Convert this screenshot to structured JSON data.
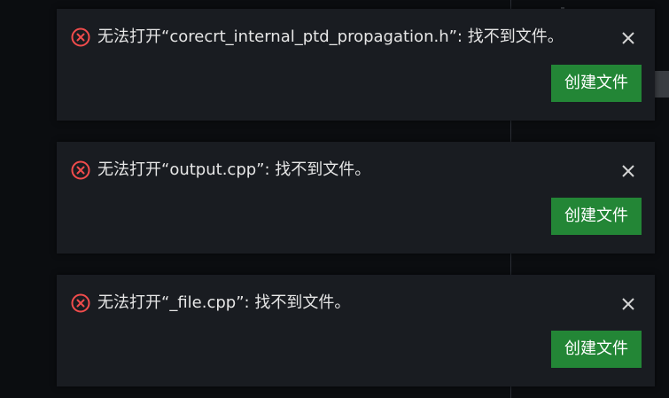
{
  "colors": {
    "background": "#0b0d10",
    "toast_bg": "#191c21",
    "error_icon": "#f14c4c",
    "button_bg": "#238636",
    "text": "#e6e6e6"
  },
  "notifications": [
    {
      "icon": "error-circle-icon",
      "message": "无法打开“corecrt_internal_ptd_propagation.h”: 找不到文件。",
      "action_label": "创建文件",
      "close_icon": "close-icon"
    },
    {
      "icon": "error-circle-icon",
      "message": "无法打开“output.cpp”: 找不到文件。",
      "action_label": "创建文件",
      "close_icon": "close-icon"
    },
    {
      "icon": "error-circle-icon",
      "message": "无法打开“_file.cpp”: 找不到文件。",
      "action_label": "创建文件",
      "close_icon": "close-icon"
    }
  ]
}
